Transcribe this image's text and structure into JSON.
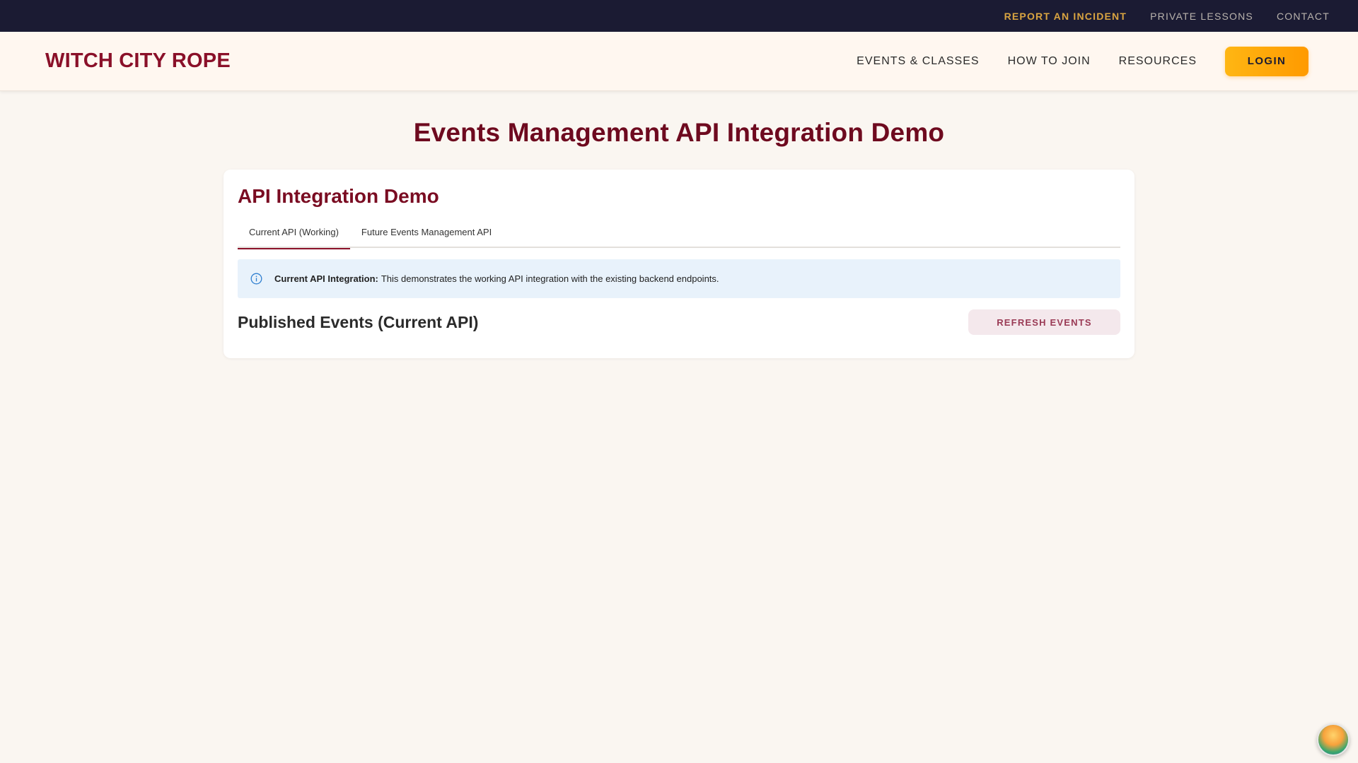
{
  "utility_bar": {
    "links": [
      {
        "label": "REPORT AN INCIDENT"
      },
      {
        "label": "PRIVATE LESSONS"
      },
      {
        "label": "CONTACT"
      }
    ]
  },
  "header": {
    "logo": "WITCH CITY ROPE",
    "nav": [
      {
        "label": "EVENTS & CLASSES"
      },
      {
        "label": "HOW TO JOIN"
      },
      {
        "label": "RESOURCES"
      }
    ],
    "login_label": "LOGIN"
  },
  "main": {
    "page_title": "Events Management API Integration Demo",
    "card": {
      "title": "API Integration Demo",
      "tabs": [
        {
          "label": "Current API (Working)",
          "active": true
        },
        {
          "label": "Future Events Management API",
          "active": false
        }
      ],
      "alert": {
        "icon": "info-icon",
        "strong": "Current API Integration:",
        "text": "This demonstrates the working API integration with the existing backend endpoints."
      },
      "section_title": "Published Events (Current API)",
      "refresh_label": "REFRESH EVENTS"
    }
  },
  "colors": {
    "brand": "#8a1029",
    "accent": "#ffb613",
    "top_bar": "#1b1b33",
    "alert_bg": "#e8f2fb"
  }
}
